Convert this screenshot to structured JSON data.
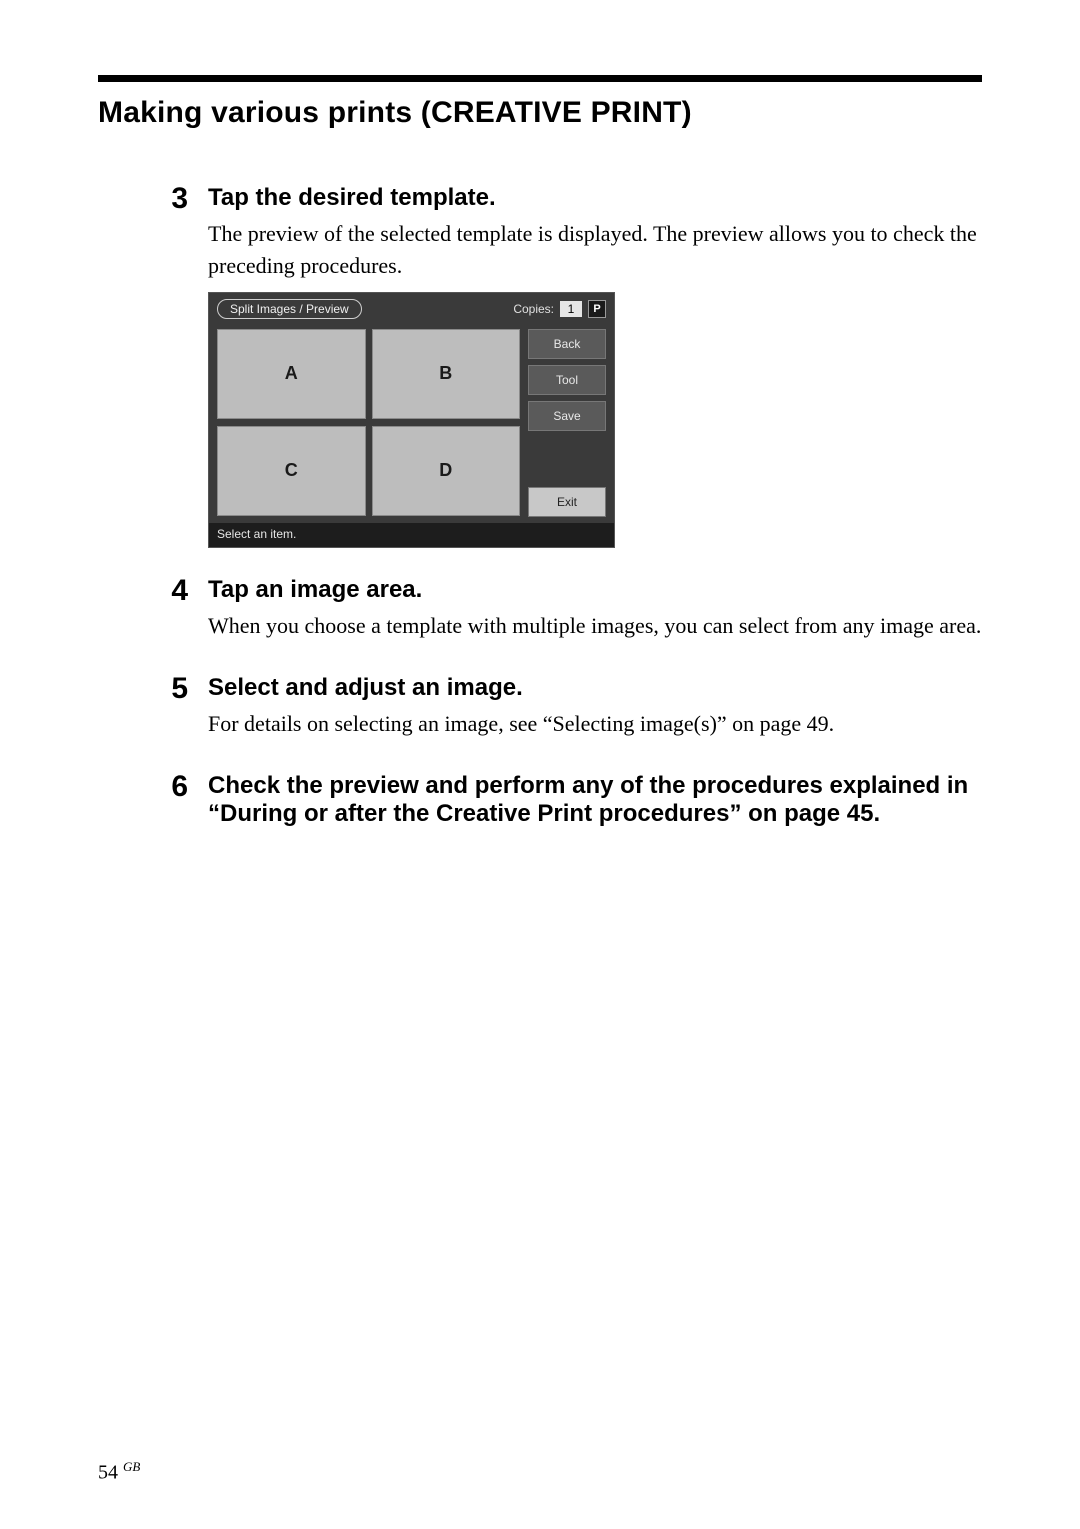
{
  "section_title": "Making various prints (CREATIVE PRINT)",
  "steps": [
    {
      "num": "3",
      "head": "Tap the desired template.",
      "desc": "The preview of the selected template is displayed.  The preview allows you to check the preceding procedures."
    },
    {
      "num": "4",
      "head": "Tap an image area.",
      "desc": "When you choose a template with multiple images, you can select from any image area."
    },
    {
      "num": "5",
      "head": "Select and adjust an image.",
      "desc": "For details on selecting an image, see “Selecting image(s)” on page 49."
    },
    {
      "num": "6",
      "head": "Check the preview and perform any of the procedures explained in “During or after the Creative Print procedures” on page 45.",
      "desc": ""
    }
  ],
  "screenshot": {
    "tab_label": "Split Images / Preview",
    "copies_label": "Copies:",
    "copies_value": "1",
    "p_badge": "P",
    "cells": {
      "a": "A",
      "b": "B",
      "c": "C",
      "d": "D"
    },
    "buttons": {
      "back": "Back",
      "tool": "Tool",
      "save": "Save",
      "exit": "Exit"
    },
    "footer": "Select an item."
  },
  "page": {
    "num": "54",
    "region": "GB"
  }
}
